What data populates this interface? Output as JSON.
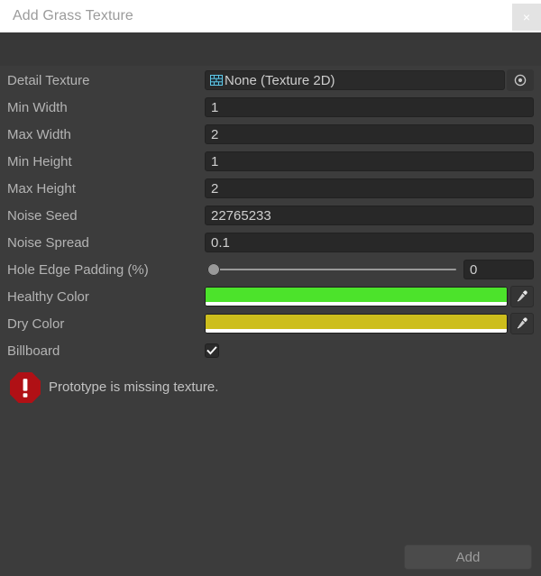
{
  "window": {
    "title": "Add Grass Texture",
    "close_label": "×",
    "close_icon": "close-icon",
    "background_color": "#3c3c3c",
    "titlebar_color": "#ffffff"
  },
  "fields": [
    {
      "label": "Detail Texture",
      "type": "object",
      "value": "None (Texture 2D)",
      "icon": "texture2d-icon",
      "picker_icon": "object-picker-icon"
    },
    {
      "label": "Min Width",
      "type": "text",
      "value": "1"
    },
    {
      "label": "Max Width",
      "type": "text",
      "value": "2"
    },
    {
      "label": "Min Height",
      "type": "text",
      "value": "1"
    },
    {
      "label": "Max Height",
      "type": "text",
      "value": "2"
    },
    {
      "label": "Noise Seed",
      "type": "text",
      "value": "22765233"
    },
    {
      "label": "Noise Spread",
      "type": "text",
      "value": "0.1"
    },
    {
      "label": "Hole Edge Padding (%)",
      "type": "slider",
      "value": "0",
      "slider_percent": 0,
      "min": 0,
      "max": 100
    },
    {
      "label": "Healthy Color",
      "type": "color",
      "color": "#4CE32B",
      "alpha_color": "#ffffff",
      "eyedropper_icon": "eyedropper-icon"
    },
    {
      "label": "Dry Color",
      "type": "color",
      "color": "#CDBE1C",
      "alpha_color": "#ffffff",
      "eyedropper_icon": "eyedropper-icon"
    },
    {
      "label": "Billboard",
      "type": "checkbox",
      "checked": true,
      "check_icon": "checkmark-icon"
    }
  ],
  "helpbox": {
    "icon": "error-icon",
    "icon_color": "#B01015",
    "message": "Prototype is missing texture."
  },
  "footer": {
    "add_label": "Add"
  }
}
